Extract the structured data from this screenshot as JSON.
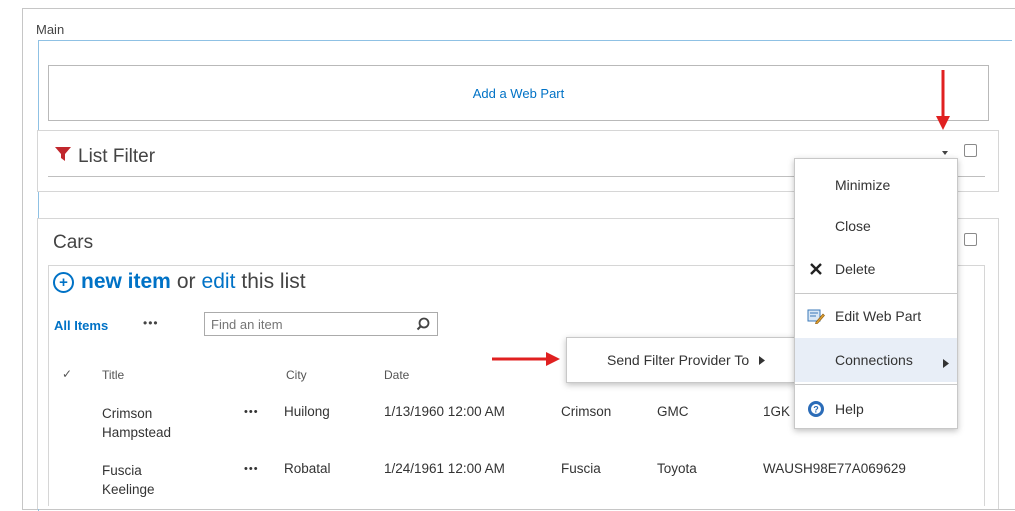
{
  "zone": {
    "label": "Main"
  },
  "add_web_part": {
    "label": "Add a Web Part"
  },
  "list_filter": {
    "title": "List Filter"
  },
  "cars": {
    "title": "Cars",
    "new_item": "new item",
    "or_text": "or",
    "edit_text": "edit",
    "this_list_text": "this list",
    "view_label": "All Items",
    "more": "•••",
    "search_placeholder": "Find an item",
    "columns": {
      "check": "✓",
      "title": "Title",
      "city": "City",
      "date": "Date"
    },
    "rows": [
      {
        "title_line1": "Crimson",
        "title_line2": "Hampstead",
        "more": "•••",
        "city": "Huilong",
        "date": "1/13/1960 12:00 AM",
        "color": "Crimson",
        "make": "GMC",
        "vin": "1GK"
      },
      {
        "title_line1": "Fuscia",
        "title_line2": "Keelinge",
        "more": "•••",
        "city": "Robatal",
        "date": "1/24/1961 12:00 AM",
        "color": "Fuscia",
        "make": "Toyota",
        "vin": "WAUSH98E77A069629"
      }
    ]
  },
  "menu": {
    "items": [
      "Minimize",
      "Close",
      "Delete",
      "Edit Web Part",
      "Connections",
      "Help"
    ]
  },
  "submenu": {
    "item": "Send Filter Provider To"
  },
  "colors": {
    "accent": "#0072c6",
    "arrow": "#e02020",
    "highlight": "#e8eef7",
    "filter_icon": "#c1272d"
  }
}
